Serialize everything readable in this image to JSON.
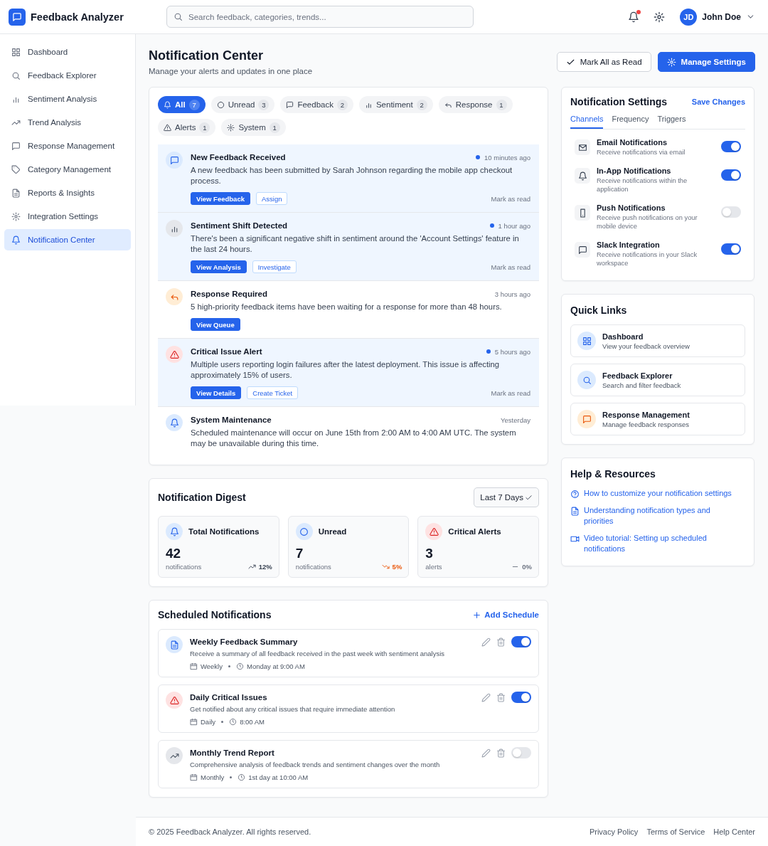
{
  "app": {
    "name": "Feedback Analyzer"
  },
  "search": {
    "placeholder": "Search feedback, categories, trends..."
  },
  "header": {
    "has_unread": true,
    "user_initials": "JD",
    "user_name": "John Doe"
  },
  "sidebar": {
    "items": [
      {
        "label": "Dashboard",
        "selected": false
      },
      {
        "label": "Feedback Explorer",
        "selected": false
      },
      {
        "label": "Sentiment Analysis",
        "selected": false
      },
      {
        "label": "Trend Analysis",
        "selected": false
      },
      {
        "label": "Response Management",
        "selected": false
      },
      {
        "label": "Category Management",
        "selected": false
      },
      {
        "label": "Reports & Insights",
        "selected": false
      },
      {
        "label": "Integration Settings",
        "selected": false
      },
      {
        "label": "Notification Center",
        "selected": true
      }
    ]
  },
  "page": {
    "title": "Notification Center",
    "subtitle": "Manage your alerts and updates in one place",
    "actions": [
      {
        "label": "Mark All as Read",
        "kind": "secondary"
      },
      {
        "label": "Manage Settings",
        "kind": "primary"
      }
    ]
  },
  "filters": [
    {
      "label": "All",
      "count": "7",
      "selected": true
    },
    {
      "label": "Unread",
      "count": "3",
      "selected": false
    },
    {
      "label": "Feedback",
      "count": "2",
      "selected": false
    },
    {
      "label": "Sentiment",
      "count": "2",
      "selected": false
    },
    {
      "label": "Response",
      "count": "1",
      "selected": false
    },
    {
      "label": "Alerts",
      "count": "1",
      "selected": false
    },
    {
      "label": "System",
      "count": "1",
      "selected": false
    }
  ],
  "notifications": [
    {
      "kind": "feedback",
      "title": "New Feedback Received",
      "time": "10 minutes ago",
      "unread": true,
      "message": "A new feedback has been submitted by Sarah Johnson regarding the mobile app checkout process.",
      "actions": [
        {
          "label": "View Feedback",
          "kind": "primary"
        },
        {
          "label": "Assign",
          "kind": "secondary"
        }
      ],
      "mark_read": "Mark as read"
    },
    {
      "kind": "sentiment",
      "title": "Sentiment Shift Detected",
      "time": "1 hour ago",
      "unread": true,
      "message": "There's been a significant negative shift in sentiment around the 'Account Settings' feature in the last 24 hours.",
      "actions": [
        {
          "label": "View Analysis",
          "kind": "primary"
        },
        {
          "label": "Investigate",
          "kind": "secondary"
        }
      ],
      "mark_read": "Mark as read"
    },
    {
      "kind": "response",
      "title": "Response Required",
      "time": "3 hours ago",
      "unread": false,
      "message": "5 high-priority feedback items have been waiting for a response for more than 48 hours.",
      "actions": [
        {
          "label": "View Queue",
          "kind": "primary"
        }
      ]
    },
    {
      "kind": "alert",
      "title": "Critical Issue Alert",
      "time": "5 hours ago",
      "unread": true,
      "message": "Multiple users reporting login failures after the latest deployment. This issue is affecting approximately 15% of users.",
      "actions": [
        {
          "label": "View Details",
          "kind": "primary"
        },
        {
          "label": "Create Ticket",
          "kind": "secondary"
        }
      ],
      "mark_read": "Mark as read"
    },
    {
      "kind": "system",
      "title": "System Maintenance",
      "time": "Yesterday",
      "unread": false,
      "message": "Scheduled maintenance will occur on June 15th from 2:00 AM to 4:00 AM UTC. The system may be unavailable during this time."
    }
  ],
  "digest": {
    "title": "Notification Digest",
    "period": "Last 7 Days",
    "cards": [
      {
        "kind": "total",
        "label": "Total Notifications",
        "value": "42",
        "unit": "notifications",
        "change": "12%"
      },
      {
        "kind": "unread",
        "label": "Unread",
        "value": "7",
        "unit": "notifications",
        "change": "5%"
      },
      {
        "kind": "critical",
        "label": "Critical Alerts",
        "value": "3",
        "unit": "alerts",
        "change": "0%"
      }
    ]
  },
  "scheduled": {
    "title": "Scheduled Notifications",
    "add_label": "Add Schedule",
    "items": [
      {
        "kind": "report",
        "title": "Weekly Feedback Summary",
        "description": "Receive a summary of all feedback received in the past week with sentiment analysis",
        "frequency": "Weekly",
        "time": "Monday at 9:00 AM",
        "on": true
      },
      {
        "kind": "alert",
        "title": "Daily Critical Issues",
        "description": "Get notified about any critical issues that require immediate attention",
        "frequency": "Daily",
        "time": "8:00 AM",
        "on": true
      },
      {
        "kind": "trend",
        "title": "Monthly Trend Report",
        "description": "Comprehensive analysis of feedback trends and sentiment changes over the month",
        "frequency": "Monthly",
        "time": "1st day at 10:00 AM",
        "on": false
      }
    ]
  },
  "settings": {
    "title": "Notification Settings",
    "save_label": "Save Changes",
    "tabs": [
      {
        "label": "Channels",
        "selected": true
      },
      {
        "label": "Frequency",
        "selected": false
      },
      {
        "label": "Triggers",
        "selected": false
      }
    ],
    "channels": [
      {
        "kind": "email",
        "title": "Email Notifications",
        "description": "Receive notifications via email",
        "on": true
      },
      {
        "kind": "inapp",
        "title": "In-App Notifications",
        "description": "Receive notifications within the application",
        "on": true
      },
      {
        "kind": "push",
        "title": "Push Notifications",
        "description": "Receive push notifications on your mobile device",
        "on": false
      },
      {
        "kind": "slack",
        "title": "Slack Integration",
        "description": "Receive notifications in your Slack workspace",
        "on": true
      }
    ]
  },
  "quick_links": {
    "title": "Quick Links",
    "items": [
      {
        "kind": "dashboard",
        "title": "Dashboard",
        "description": "View your feedback overview"
      },
      {
        "kind": "explorer",
        "title": "Feedback Explorer",
        "description": "Search and filter feedback"
      },
      {
        "kind": "response",
        "title": "Response Management",
        "description": "Manage feedback responses"
      }
    ]
  },
  "help": {
    "title": "Help & Resources",
    "links": [
      {
        "kind": "help",
        "label": "How to customize your notification settings"
      },
      {
        "kind": "doc",
        "label": "Understanding notification types and priorities"
      },
      {
        "kind": "video",
        "label": "Video tutorial: Setting up scheduled notifications"
      }
    ]
  },
  "footer": {
    "copyright": "© 2025 Feedback Analyzer. All rights reserved.",
    "links": [
      "Privacy Policy",
      "Terms of Service",
      "Help Center"
    ]
  }
}
